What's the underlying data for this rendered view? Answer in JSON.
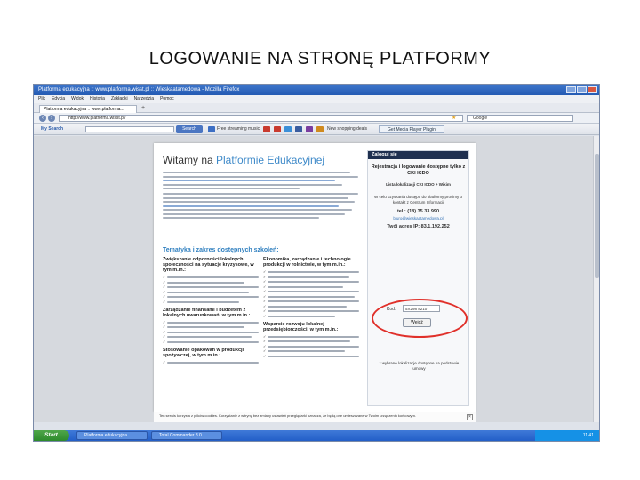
{
  "slide_title": "LOGOWANIE NA STRONĘ PLATFORMY",
  "browser": {
    "window_title": "Platforma edukacyjna :: www.platforma.wisst.pl :: Wieskaatamedowa - Mozilla Firefox",
    "menu": [
      "Plik",
      "Edycja",
      "Widok",
      "Historia",
      "Zakładki",
      "Narzędzia",
      "Pomoc"
    ],
    "tab_label": "Platforma edukacyjna :: www.platforma...",
    "url": "http://www.platforma.wisst.pl/",
    "search_placeholder": "Google"
  },
  "toolbar": {
    "brand": "My Search",
    "search_button": "Search",
    "items": [
      "Free streaming music",
      "New shopping deals"
    ],
    "media_button": "Get Media Player Plugin"
  },
  "page": {
    "heading_plain": "Witamy na ",
    "heading_highlight": "Platformie Edukacyjnej",
    "section_title": "Tematyka i zakres dostępnych szkoleń:",
    "col1": {
      "h1": "Zwiększanie odporności lokalnych społeczności na sytuacje kryzysowe, w tym m.in.:",
      "h2": "Zarządzanie finansami i budżetem z lokalnych uwarunkowań, w tym m.in.:",
      "h3": "Stosowanie opakowań w produkcji spożywczej, w tym m.in.:"
    },
    "col2": {
      "h1": "Ekonomika, zarządzanie i technologie produkcji w rolnictwie, w tym m.in.:",
      "h2": "Wsparcie rozwoju lokalnej przedsiębiorczości, w tym m.in.:"
    }
  },
  "sidebar": {
    "header": "Zaloguj się",
    "title": "Rejestracja i logowanie dostępne tylko z CKI ICDO",
    "text1": "Lista lokalizacji CKI ICDO + Wikim",
    "text2": "W celu uzyskania dostępu do platformy prosimy o kontakt z Centrum Informacji",
    "tel": "tel.: (18) 35 33 990",
    "email": "biuro@wieskaatamedowa.pl",
    "ipaddr": "Twój adres IP: 83.1.192.252",
    "login_label": "Kod:",
    "login_value": "5X298 8210",
    "login_button": "Wejdź",
    "note": "* wybrane lokalizacje dostępne na podstawie umowy"
  },
  "cookie_notice": "Ten serwis korzysta z plików cookies. Korzystanie z witryny bez zmiany ustawień przeglądarki oznacza, że będą one umieszczane w Twoim urządzeniu końcowym.",
  "taskbar": {
    "start": "Start",
    "tasks": [
      "Platforma edukacyjna...",
      "Total Commander 8.0..."
    ],
    "clock": "11:41"
  }
}
